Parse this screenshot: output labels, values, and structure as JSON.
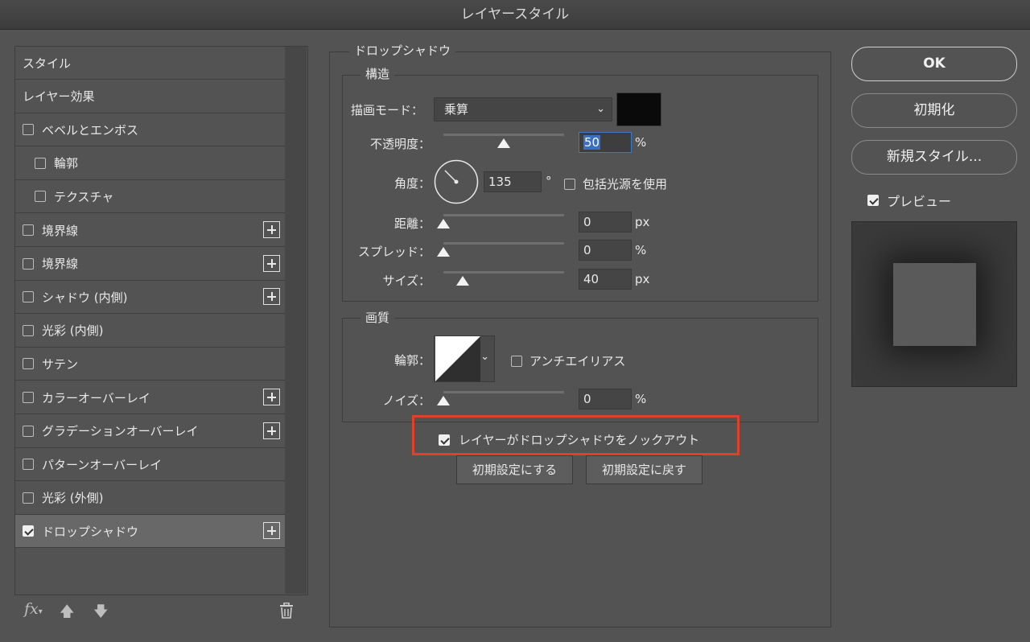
{
  "window": {
    "title": "レイヤースタイル"
  },
  "sidebar": {
    "items": [
      {
        "label": "スタイル",
        "checkbox": false,
        "checked": false,
        "indent": false,
        "plus": false,
        "selected": false
      },
      {
        "label": "レイヤー効果",
        "checkbox": false,
        "checked": false,
        "indent": false,
        "plus": false,
        "selected": false
      },
      {
        "label": "ベベルとエンボス",
        "checkbox": true,
        "checked": false,
        "indent": false,
        "plus": false,
        "selected": false
      },
      {
        "label": "輪郭",
        "checkbox": true,
        "checked": false,
        "indent": true,
        "plus": false,
        "selected": false
      },
      {
        "label": "テクスチャ",
        "checkbox": true,
        "checked": false,
        "indent": true,
        "plus": false,
        "selected": false
      },
      {
        "label": "境界線",
        "checkbox": true,
        "checked": false,
        "indent": false,
        "plus": true,
        "selected": false
      },
      {
        "label": "境界線",
        "checkbox": true,
        "checked": false,
        "indent": false,
        "plus": true,
        "selected": false
      },
      {
        "label": "シャドウ (内側)",
        "checkbox": true,
        "checked": false,
        "indent": false,
        "plus": true,
        "selected": false
      },
      {
        "label": "光彩 (内側)",
        "checkbox": true,
        "checked": false,
        "indent": false,
        "plus": false,
        "selected": false
      },
      {
        "label": "サテン",
        "checkbox": true,
        "checked": false,
        "indent": false,
        "plus": false,
        "selected": false
      },
      {
        "label": "カラーオーバーレイ",
        "checkbox": true,
        "checked": false,
        "indent": false,
        "plus": true,
        "selected": false
      },
      {
        "label": "グラデーションオーバーレイ",
        "checkbox": true,
        "checked": false,
        "indent": false,
        "plus": true,
        "selected": false
      },
      {
        "label": "パターンオーバーレイ",
        "checkbox": true,
        "checked": false,
        "indent": false,
        "plus": false,
        "selected": false
      },
      {
        "label": "光彩 (外側)",
        "checkbox": true,
        "checked": false,
        "indent": false,
        "plus": false,
        "selected": false
      },
      {
        "label": "ドロップシャドウ",
        "checkbox": true,
        "checked": true,
        "indent": false,
        "plus": true,
        "selected": true
      }
    ],
    "toolbar": {
      "fx_label": "fx"
    }
  },
  "main": {
    "section_title": "ドロップシャドウ",
    "structure": {
      "title": "構造",
      "blend_mode_label": "描画モード：",
      "blend_mode_value": "乗算",
      "shadow_color": "#0a0a0a",
      "opacity_label": "不透明度：",
      "opacity_value": "50",
      "opacity_unit": "%",
      "opacity_level": 50,
      "angle_label": "角度：",
      "angle_value": "135",
      "angle_unit": "°",
      "global_light_label": "包括光源を使用",
      "global_light_checked": false,
      "distance_label": "距離：",
      "distance_value": "0",
      "distance_unit": "px",
      "distance_level": 0,
      "spread_label": "スプレッド：",
      "spread_value": "0",
      "spread_unit": "%",
      "spread_level": 0,
      "size_label": "サイズ：",
      "size_value": "40",
      "size_unit": "px",
      "size_level": 16
    },
    "quality": {
      "title": "画質",
      "contour_label": "輪郭：",
      "antialias_label": "アンチエイリアス",
      "antialias_checked": false,
      "noise_label": "ノイズ：",
      "noise_value": "0",
      "noise_unit": "%",
      "noise_level": 0
    },
    "knockout_label": "レイヤーがドロップシャドウをノックアウト",
    "knockout_checked": true,
    "highlight_color": "#e0412b",
    "make_default_label": "初期設定にする",
    "reset_default_label": "初期設定に戻す"
  },
  "actions": {
    "ok_label": "OK",
    "reset_label": "初期化",
    "new_style_label": "新規スタイル...",
    "preview_label": "プレビュー",
    "preview_checked": true
  }
}
